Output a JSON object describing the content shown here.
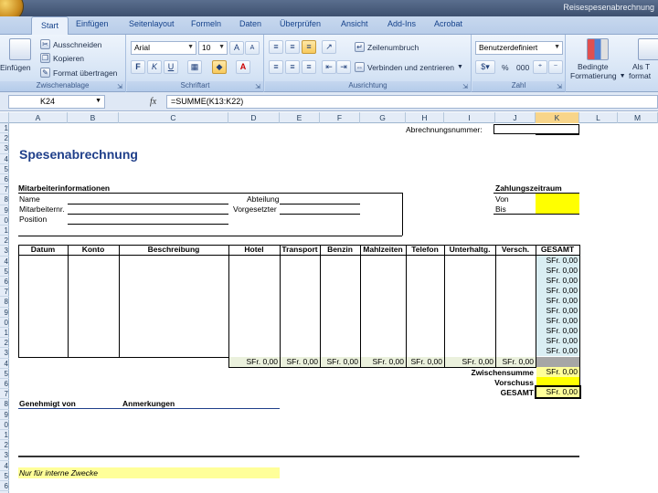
{
  "window": {
    "title": "Reisespesenabrechnung"
  },
  "ribbon_tabs": [
    "Start",
    "Einfügen",
    "Seitenlayout",
    "Formeln",
    "Daten",
    "Überprüfen",
    "Ansicht",
    "Add-Ins",
    "Acrobat"
  ],
  "clipboard": {
    "paste": "Einfügen",
    "cut": "Ausschneiden",
    "copy": "Kopieren",
    "format_painter": "Format übertragen",
    "label": "Zwischenablage"
  },
  "font": {
    "name": "Arial",
    "size": "10",
    "bold": "F",
    "italic": "K",
    "underline": "U",
    "label": "Schriftart"
  },
  "alignment": {
    "wrap": "Zeilenumbruch",
    "merge": "Verbinden und zentrieren",
    "label": "Ausrichtung"
  },
  "number": {
    "format": "Benutzerdefiniert",
    "percent": "%",
    "thousands": "000",
    "label": "Zahl"
  },
  "styles": {
    "conditional": "Bedingte",
    "conditional2": "Formatierung",
    "astable": "Als T",
    "astable2": "format"
  },
  "formula_bar": {
    "cell": "K24",
    "fx": "fx",
    "formula": "=SUMME(K13:K22)"
  },
  "columns": [
    "A",
    "B",
    "C",
    "D",
    "E",
    "F",
    "G",
    "H",
    "I",
    "J",
    "K",
    "L",
    "M"
  ],
  "rows": [
    "1",
    "2",
    "3",
    "4",
    "5",
    "6",
    "7",
    "8",
    "9",
    "0",
    "1",
    "2",
    "3",
    "4",
    "5",
    "6",
    "7",
    "8",
    "9",
    "0",
    "1",
    "2",
    "3",
    "4",
    "5",
    "6",
    "7",
    "8",
    "9",
    "0",
    "1",
    "2",
    "3",
    "4",
    "5",
    "6"
  ],
  "sheet": {
    "invoice_no_label": "Abrechnungsnummer:",
    "title": "Spesenabrechnung",
    "employee_info": "Mitarbeiterinformationen",
    "payment_period": "Zahlungszeitraum",
    "name": "Name",
    "employee_no": "Mitarbeiternr.",
    "position": "Position",
    "department": "Abteilung",
    "supervisor": "Vorgesetzter",
    "from": "Von",
    "to": "Bis",
    "headers": [
      "Datum",
      "Konto",
      "Beschreibung",
      "Hotel",
      "Transport",
      "Benzin",
      "Mahlzeiten",
      "Telefon",
      "Unterhaltg.",
      "Versch.",
      "GESAMT"
    ],
    "row_total": "SFr. 0,00",
    "totals": [
      "SFr. 0,00",
      "SFr. 0,00",
      "SFr. 0,00",
      "SFr. 0,00",
      "SFr. 0,00",
      "SFr. 0,00",
      "SFr. 0,00"
    ],
    "subtotal_label": "Zwischensumme",
    "subtotal_value": "SFr. 0,00",
    "advance_label": "Vorschuss",
    "total_label": "GESAMT",
    "total_value": "SFr. 0,00",
    "approved_by": "Genehmigt von",
    "remarks": "Anmerkungen",
    "internal": "Nur für interne Zwecke"
  },
  "colors": {
    "yellow": "#ffff00",
    "accent_title": "#1f3f8a"
  }
}
